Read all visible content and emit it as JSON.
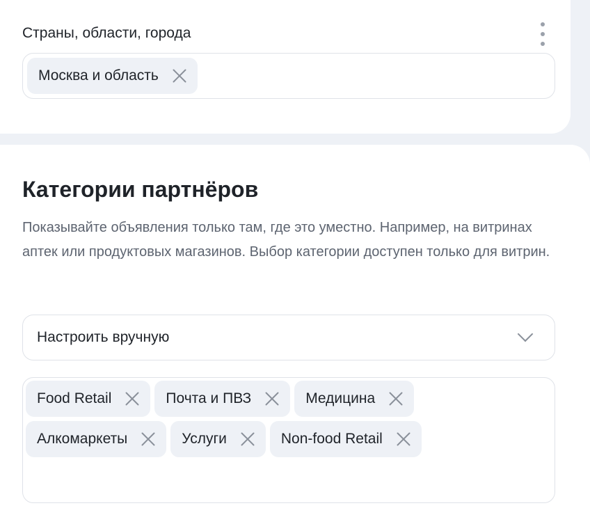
{
  "geo": {
    "label": "Страны, области, города",
    "chips": [
      {
        "label": "Москва и область"
      }
    ]
  },
  "partners": {
    "title": "Категории партнёров",
    "description": "Показывайте объявления только там, где это уместно. Например, на витринах аптек или продуктовых магазинов. Выбор категории доступен только для витрин.",
    "mode_select": {
      "value": "Настроить вручную"
    },
    "chips": [
      {
        "label": "Food Retail"
      },
      {
        "label": "Почта и ПВЗ"
      },
      {
        "label": "Медицина"
      },
      {
        "label": "Алкомаркеты"
      },
      {
        "label": "Услуги"
      },
      {
        "label": "Non-food Retail"
      }
    ]
  },
  "icons": {
    "more": "more-vertical-icon",
    "remove": "close-icon",
    "dropdown": "chevron-down-icon"
  },
  "colors": {
    "background": "#eef1f6",
    "chip": "#eef1f6",
    "text": "#1f2329",
    "muted_text": "#5d6470",
    "icon": "#8a909a"
  }
}
